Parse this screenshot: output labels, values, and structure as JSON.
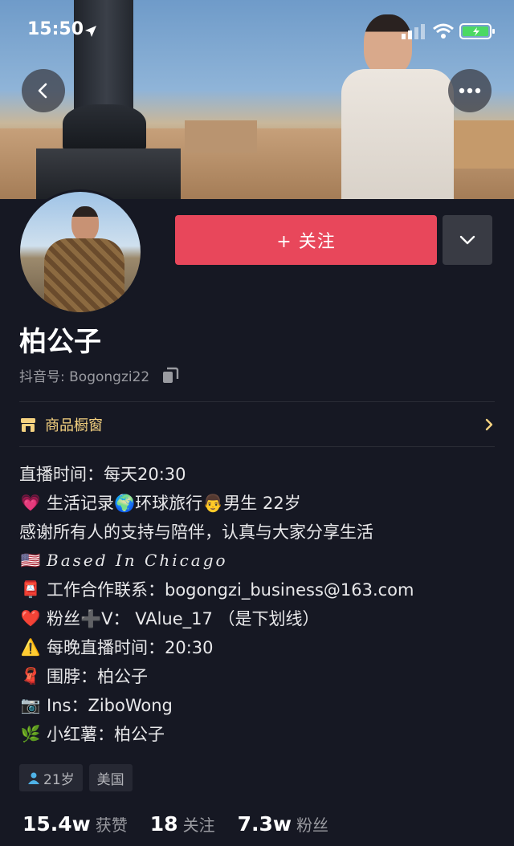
{
  "status_bar": {
    "time": "15:50"
  },
  "profile": {
    "name": "柏公子",
    "douyin_id": "抖音号: Bogongzi22",
    "follow_label": "+ 关注",
    "shop_label": "商品橱窗"
  },
  "bio": {
    "lines": [
      {
        "emoji": "",
        "text": "直播时间：每天20:30"
      },
      {
        "emoji": "💗",
        "text": "生活记录🌍环球旅行👨男生 22岁"
      },
      {
        "emoji": "",
        "text": "感谢所有人的支持与陪伴，认真与大家分享生活"
      },
      {
        "emoji": "🇺🇸",
        "text": "Based In Chicago"
      },
      {
        "emoji": "📮",
        "text": "工作合作联系：bogongzi_business@163.com"
      },
      {
        "emoji": "❤️",
        "text": "粉丝➕V：  VAlue_17 （是下划线）"
      },
      {
        "emoji": "⚠️",
        "text": "每晚直播时间：20:30"
      },
      {
        "emoji": "🧣",
        "text": "围脖：柏公子"
      },
      {
        "emoji": "📷",
        "text": "Ins：ZiboWong"
      },
      {
        "emoji": "🌿",
        "text": "小红薯：柏公子"
      }
    ]
  },
  "tags": {
    "age": "21岁",
    "region": "美国"
  },
  "stats": {
    "likes_num": "15.4w",
    "likes_label": "获赞",
    "following_num": "18",
    "following_label": "关注",
    "fans_num": "7.3w",
    "fans_label": "粉丝"
  },
  "icons": {
    "back": "chevron-left-icon",
    "more": "ellipsis-icon",
    "dropdown": "chevron-down-icon",
    "copy": "copy-icon",
    "shop": "shop-icon"
  },
  "colors": {
    "accent": "#e8475b",
    "background": "#161823",
    "shop": "#f5d280"
  }
}
